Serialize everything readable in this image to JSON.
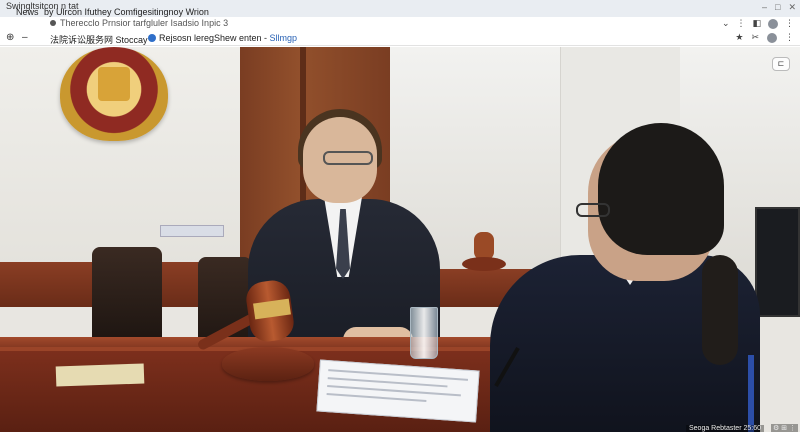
{
  "browser": {
    "tab_title": "Swingltsitcon n tat",
    "news_label": "News",
    "news_text": "by Ulrcon Ifuthey Comfigesitingnoy Wrion",
    "url": "Therecclo Prnsior tarfgluler Isadsio Inpic 3",
    "window_controls": [
      "–",
      "□",
      "✕"
    ],
    "toolbar_icons": [
      "chevron-down",
      "more",
      "extension",
      "profile",
      "menu"
    ]
  },
  "bookmarks": {
    "nav": [
      "⊕",
      "–"
    ],
    "items": [
      {
        "label": "法院诉讼服务网 Stoccay",
        "style": "default"
      },
      {
        "label": "Rejsosn lereg",
        "style": "default"
      },
      {
        "label": "Shew enten - Sllmgp",
        "style": "blue"
      }
    ],
    "right_icons": [
      "★",
      "✂",
      "●",
      "⋮"
    ]
  },
  "scene": {
    "toggle_label": "⊏"
  },
  "status": {
    "text": "Seoga Rebtaster 25:60",
    "icons": "⚙ ⊞ ⋮"
  }
}
